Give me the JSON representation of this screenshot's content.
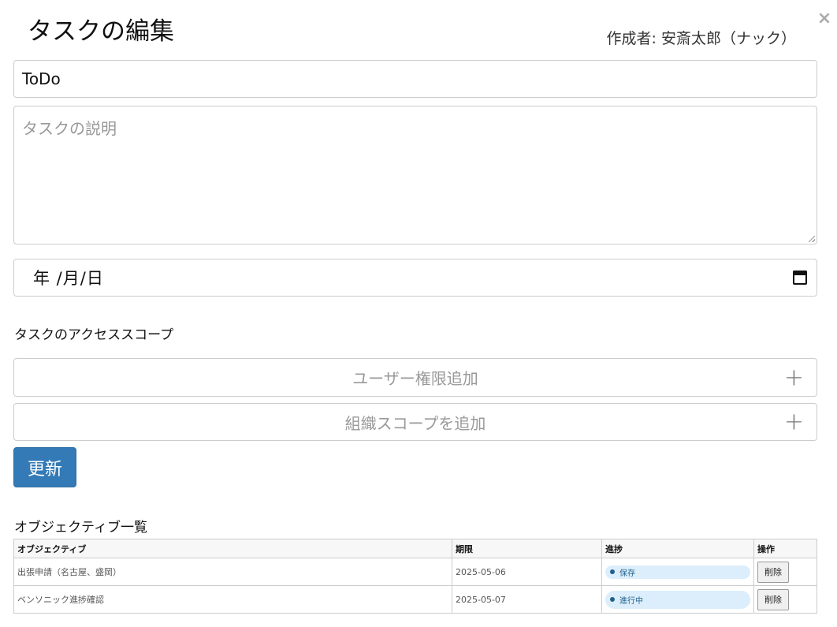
{
  "modal": {
    "title": "タスクの編集",
    "author": "作成者: 安斎太郎（ナック）",
    "close_icon": "×"
  },
  "form": {
    "title_value": "ToDo",
    "description_placeholder": "タスクの説明",
    "date_placeholder": "年 /月/日",
    "date_icon": "calendar-icon"
  },
  "scope": {
    "label": "タスクのアクセススコープ",
    "user_add_label": "ユーザー権限追加",
    "org_add_label": "組織スコープを追加",
    "plus_icon": "+"
  },
  "update_button": "更新",
  "objectives": {
    "label": "オブジェクティブ一覧",
    "headers": [
      "オブジェクティブ",
      "期限",
      "進捗",
      "操作"
    ],
    "rows": [
      {
        "name": "出張申請（名古屋、盛岡）",
        "due": "2025-05-06",
        "status": "保存",
        "action": "削除"
      },
      {
        "name": "ベンソニック進捗確認",
        "due": "2025-05-07",
        "status": "進行中",
        "action": "削除"
      }
    ]
  },
  "colors": {
    "primary": "#337ab7",
    "badge_bg": "#dceefb",
    "badge_text": "#1f5f8b"
  }
}
